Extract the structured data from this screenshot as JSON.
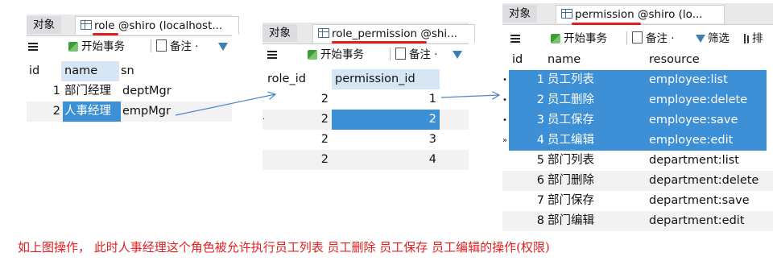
{
  "panels": {
    "role": {
      "obj_tab": "对象",
      "tab_prefix": "role",
      "tab_suffix": " @shiro (localhost...",
      "toolbar_begin": "开始事务",
      "toolbar_note": "备注 ·",
      "columns": [
        "id",
        "name",
        "sn"
      ],
      "rows": [
        {
          "id": "1",
          "name": "部门经理",
          "sn": "deptMgr"
        },
        {
          "id": "2",
          "name": "人事经理",
          "sn": "empMgr"
        }
      ]
    },
    "role_permission": {
      "obj_tab": "对象",
      "tab_prefix": "role_permission",
      "tab_suffix": " @shi...",
      "toolbar_begin": "开始事务",
      "toolbar_note": "备注 ·",
      "columns": [
        "role_id",
        "permission_id"
      ],
      "rows": [
        {
          "role_id": "2",
          "permission_id": "1"
        },
        {
          "role_id": "2",
          "permission_id": "2"
        },
        {
          "role_id": "2",
          "permission_id": "3"
        },
        {
          "role_id": "2",
          "permission_id": "4"
        }
      ]
    },
    "permission": {
      "obj_tab": "对象",
      "tab_title": "permission @shiro (lo...",
      "toolbar_begin": "开始事务",
      "toolbar_note": "备注 ·",
      "toolbar_filter": "筛选",
      "toolbar_sort": "排",
      "columns": [
        "id",
        "name",
        "resource"
      ],
      "rows": [
        {
          "id": "1",
          "name": "员工列表",
          "resource": "employee:list"
        },
        {
          "id": "2",
          "name": "员工删除",
          "resource": "employee:delete"
        },
        {
          "id": "3",
          "name": "员工保存",
          "resource": "employee:save"
        },
        {
          "id": "4",
          "name": "员工编辑",
          "resource": "employee:edit"
        },
        {
          "id": "5",
          "name": "部门列表",
          "resource": "department:list"
        },
        {
          "id": "6",
          "name": "部门删除",
          "resource": "department:delete"
        },
        {
          "id": "7",
          "name": "部门保存",
          "resource": "department:save"
        },
        {
          "id": "8",
          "name": "部门编辑",
          "resource": "department:edit"
        }
      ]
    }
  },
  "caption": "如上图操作， 此时人事经理这个角色被允许执行员工列表 员工删除 员工保存 员工编辑的操作(权限)",
  "colors": {
    "selection": "#3d8fd6",
    "annotation": "#e02020",
    "arrow": "#4a86c5"
  }
}
